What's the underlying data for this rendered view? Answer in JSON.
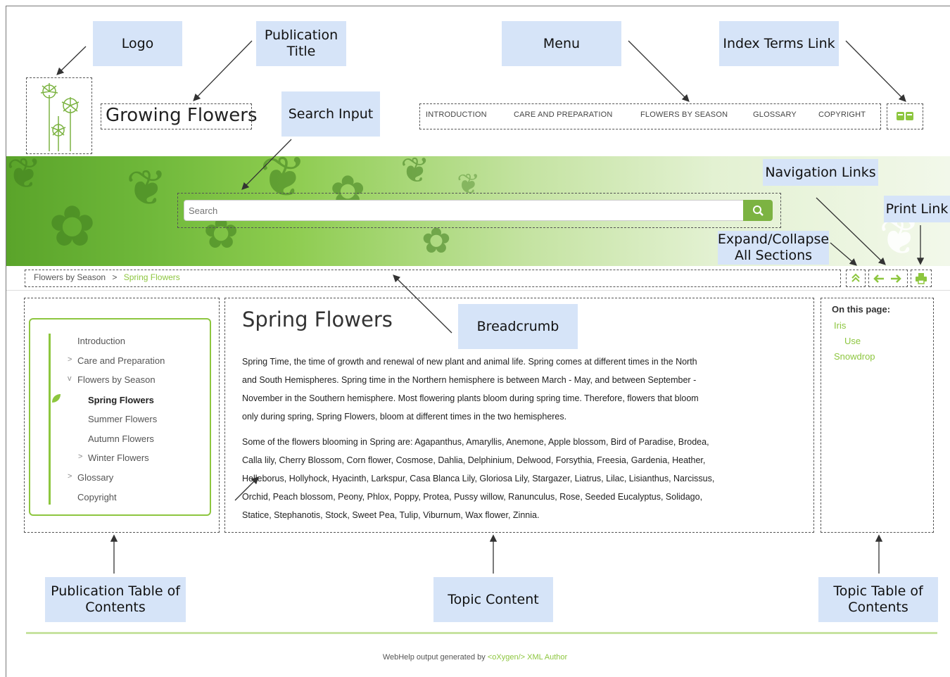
{
  "callouts": {
    "logo": "Logo",
    "publication_title": "Publication Title",
    "menu": "Menu",
    "index_terms_link": "Index Terms Link",
    "search_input": "Search Input",
    "navigation_links": "Navigation Links",
    "print_link": "Print Link",
    "expand_collapse": "Expand/Collapse All Sections",
    "breadcrumb": "Breadcrumb",
    "publication_toc": "Publication Table of Contents",
    "topic_content": "Topic Content",
    "topic_toc": "Topic Table of Contents"
  },
  "header": {
    "title": "Growing Flowers",
    "menu": [
      "INTRODUCTION",
      "CARE AND PREPARATION",
      "FLOWERS BY SEASON",
      "GLOSSARY",
      "COPYRIGHT"
    ]
  },
  "search": {
    "placeholder": "Search"
  },
  "breadcrumb": {
    "parent": "Flowers by Season",
    "separator": ">",
    "current": "Spring Flowers"
  },
  "toc": {
    "items": [
      {
        "label": "Introduction",
        "marker": ""
      },
      {
        "label": "Care and Preparation",
        "marker": ">"
      },
      {
        "label": "Flowers by Season",
        "marker": "v"
      },
      {
        "label": "Spring Flowers",
        "marker": ""
      },
      {
        "label": "Summer Flowers",
        "marker": ""
      },
      {
        "label": "Autumn Flowers",
        "marker": ""
      },
      {
        "label": "Winter Flowers",
        "marker": ">"
      },
      {
        "label": "Glossary",
        "marker": ">"
      },
      {
        "label": "Copyright",
        "marker": ""
      }
    ]
  },
  "topic": {
    "title": "Spring Flowers",
    "para1_lines": [
      "Spring Time, the time of growth and renewal of new plant and animal life. Spring comes at different times in the North",
      "and South Hemispheres. Spring time in the Northern hemisphere is between March - May, and between September -",
      "November in the Southern hemisphere. Most flowering plants bloom during spring time. Therefore, flowers that bloom",
      "only during spring, Spring Flowers, bloom at different times in the two hemispheres."
    ],
    "para2_lines": [
      "Some of the flowers blooming in Spring are: Agapanthus, Amaryllis, Anemone, Apple blossom, Bird of Paradise, Brodea,",
      "Calla lily, Cherry Blossom, Corn flower, Cosmose, Dahlia, Delphinium, Delwood, Forsythia, Freesia, Gardenia, Heather,",
      "Helleborus, Hollyhock, Hyacinth, Larkspur, Casa Blanca Lily, Gloriosa Lily, Stargazer, Liatrus, Lilac, Lisianthus, Narcissus,",
      "Orchid, Peach blossom, Peony, Phlox, Poppy, Protea, Pussy willow, Ranunculus, Rose, Seeded Eucalyptus, Solidago,",
      "Statice, Stephanotis, Stock, Sweet Pea, Tulip, Viburnum, Wax flower, Zinnia."
    ]
  },
  "on_this_page": {
    "heading": "On this page:",
    "items": [
      "Iris",
      "Use",
      "Snowdrop"
    ]
  },
  "footer": {
    "prefix": "WebHelp output generated by",
    "link": "<oXygen/> XML Author"
  },
  "colors": {
    "accent": "#8dc63f",
    "callout_bg": "#d6e4f8",
    "dash": "#555555"
  },
  "icons": {
    "logo": "flower-logo-icon",
    "index": "book-icon",
    "search": "search-icon",
    "expand": "expand-collapse-icon",
    "prev": "arrow-left-icon",
    "next": "arrow-right-icon",
    "print": "print-icon",
    "leaf": "leaf-icon"
  }
}
